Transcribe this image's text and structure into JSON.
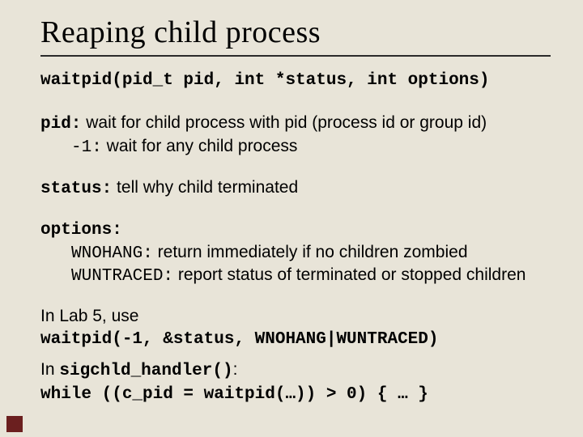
{
  "title": "Reaping child process",
  "signature": "waitpid(pid_t pid, int *status, int options)",
  "pid": {
    "label": "pid:",
    "desc": " wait for child process with pid (process id or group id)",
    "neg1_label": "-1:",
    "neg1_desc": " wait for any child process"
  },
  "status": {
    "label": "status:",
    "desc": " tell why child terminated"
  },
  "options": {
    "label": "options:",
    "wnohang_label": "WNOHANG:",
    "wnohang_desc": " return immediately if no children zombied",
    "wuntraced_label": "WUNTRACED:",
    "wuntraced_desc": " report status of terminated or stopped children"
  },
  "lab": {
    "intro": "In Lab 5, use",
    "code": "waitpid(-1, &status, WNOHANG|WUNTRACED)"
  },
  "handler": {
    "intro_prefix": "In ",
    "intro_code": "sigchld_handler()",
    "intro_suffix": ":",
    "code": "while ((c_pid = waitpid(…)) > 0) { … }"
  }
}
